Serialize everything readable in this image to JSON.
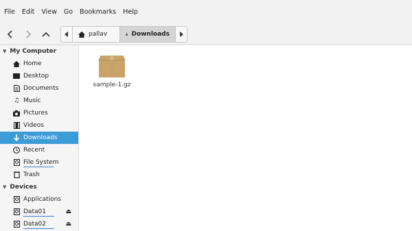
{
  "menu": [
    "File",
    "Edit",
    "View",
    "Go",
    "Bookmarks",
    "Help"
  ],
  "toolbar": {
    "back_icon": "chevron-left-icon",
    "forward_icon": "chevron-right-icon",
    "up_icon": "chevron-up-icon"
  },
  "path": {
    "home_crumb": "pallav",
    "current_crumb": "Downloads"
  },
  "sidebar": {
    "section_my_computer": "My Computer",
    "my_computer_items": [
      {
        "label": "Home",
        "icon": "home-icon"
      },
      {
        "label": "Desktop",
        "icon": "desktop-icon"
      },
      {
        "label": "Documents",
        "icon": "documents-icon"
      },
      {
        "label": "Music",
        "icon": "music-icon"
      },
      {
        "label": "Pictures",
        "icon": "pictures-icon"
      },
      {
        "label": "Videos",
        "icon": "videos-icon"
      },
      {
        "label": "Downloads",
        "icon": "download-icon"
      },
      {
        "label": "Recent",
        "icon": "recent-icon"
      },
      {
        "label": "File System",
        "icon": "drive-icon"
      },
      {
        "label": "Trash",
        "icon": "trash-icon"
      }
    ],
    "section_devices": "Devices",
    "device_items": [
      {
        "label": "Applications",
        "icon": "drive-icon"
      },
      {
        "label": "Data01",
        "icon": "drive-icon"
      },
      {
        "label": "Data02",
        "icon": "drive-icon"
      }
    ]
  },
  "files": [
    {
      "name": "sample-1.gz",
      "icon": "archive-icon"
    }
  ],
  "colors": {
    "selection": "#3d9bd8",
    "archive_box": "#c9a46a"
  }
}
